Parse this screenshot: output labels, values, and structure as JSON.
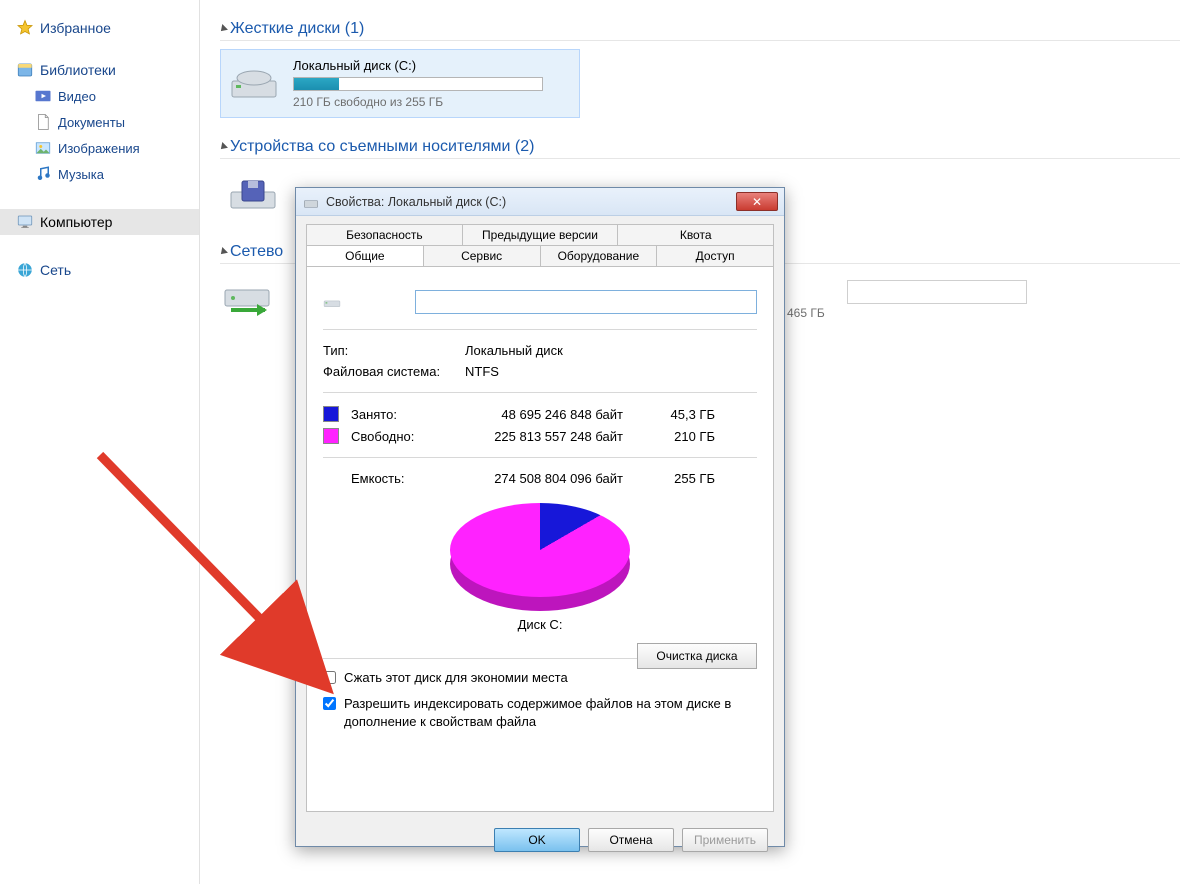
{
  "sidebar": {
    "favorites": "Избранное",
    "libraries": "Библиотеки",
    "videos": "Видео",
    "documents": "Документы",
    "images": "Изображения",
    "music": "Музыка",
    "computer": "Компьютер",
    "network": "Сеть"
  },
  "main": {
    "hdd_header": "Жесткие диски (1)",
    "drive_name": "Локальный диск (C:)",
    "drive_free_line": "210 ГБ свободно из 255 ГБ",
    "drive_fill_percent": 18,
    "removable_header": "Устройства со съемными носителями (2)",
    "network_header": "Сетево",
    "net_size": "465 ГБ"
  },
  "dialog": {
    "title": "Свойства: Локальный диск (C:)",
    "tabs_row1": [
      "Безопасность",
      "Предыдущие версии",
      "Квота"
    ],
    "tabs_row2": [
      "Общие",
      "Сервис",
      "Оборудование",
      "Доступ"
    ],
    "name_value": "",
    "type_label": "Тип:",
    "type_value": "Локальный диск",
    "fs_label": "Файловая система:",
    "fs_value": "NTFS",
    "used_label": "Занято:",
    "used_bytes": "48 695 246 848 байт",
    "used_gb": "45,3 ГБ",
    "free_label": "Свободно:",
    "free_bytes": "225 813 557 248 байт",
    "free_gb": "210 ГБ",
    "cap_label": "Емкость:",
    "cap_bytes": "274 508 804 096 байт",
    "cap_gb": "255 ГБ",
    "disk_label": "Диск C:",
    "cleanup_label": "Очистка диска",
    "compress_label": "Сжать этот диск для экономии места",
    "compress_checked": false,
    "index_label": "Разрешить индексировать содержимое файлов на этом диске в дополнение к свойствам файла",
    "index_checked": true,
    "ok": "OK",
    "cancel": "Отмена",
    "apply": "Применить"
  },
  "chart_data": {
    "type": "pie",
    "title": "Диск C:",
    "series": [
      {
        "name": "Занято",
        "value": 48695246848,
        "color": "#1717d9"
      },
      {
        "name": "Свободно",
        "value": 225813557248,
        "color": "#ff22ff"
      }
    ]
  }
}
